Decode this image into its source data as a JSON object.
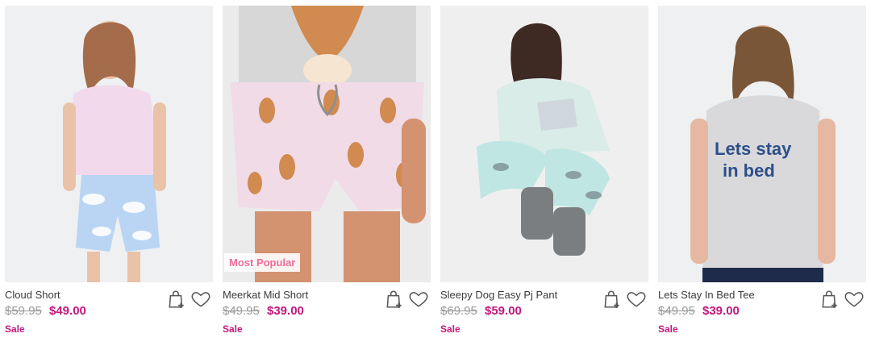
{
  "products": [
    {
      "name": "Cloud Short",
      "price_was": "$59.95",
      "price_now": "$49.00",
      "tag": "Sale",
      "badge": "",
      "image_theme": "pink tee, blue cloud shorts",
      "colors": {
        "bg": "#eef0f1",
        "top": "#f3d9ec",
        "bottom": "#b9d5f3",
        "accent": "#ffffff"
      }
    },
    {
      "name": "Meerkat Mid Short",
      "price_was": "$49.95",
      "price_now": "$39.00",
      "tag": "Sale",
      "badge": "Most Popular",
      "image_theme": "meerkat print shorts",
      "colors": {
        "bg": "#ecebeb",
        "top": "#d7d7d7",
        "bottom": "#f0dbe7",
        "accent": "#d18a4f"
      }
    },
    {
      "name": "Sleepy Dog Easy Pj Pant",
      "price_was": "$69.95",
      "price_now": "$59.00",
      "tag": "Sale",
      "badge": "",
      "image_theme": "mint pj with dog print",
      "colors": {
        "bg": "#efefef",
        "top": "#d9ece8",
        "bottom": "#bfe6e2",
        "accent": "#6e6e6e"
      }
    },
    {
      "name": "Lets Stay In Bed Tee",
      "price_was": "$49.95",
      "price_now": "$39.00",
      "tag": "Sale",
      "badge": "",
      "image_theme": "grey tee with blue text",
      "colors": {
        "bg": "#eef0f1",
        "top": "#d9d9db",
        "bottom": "#1f2b4a",
        "accent": "#2d4f8a"
      }
    }
  ],
  "icons": {
    "add_to_bag": "bag-plus-icon",
    "wishlist": "heart-icon"
  }
}
